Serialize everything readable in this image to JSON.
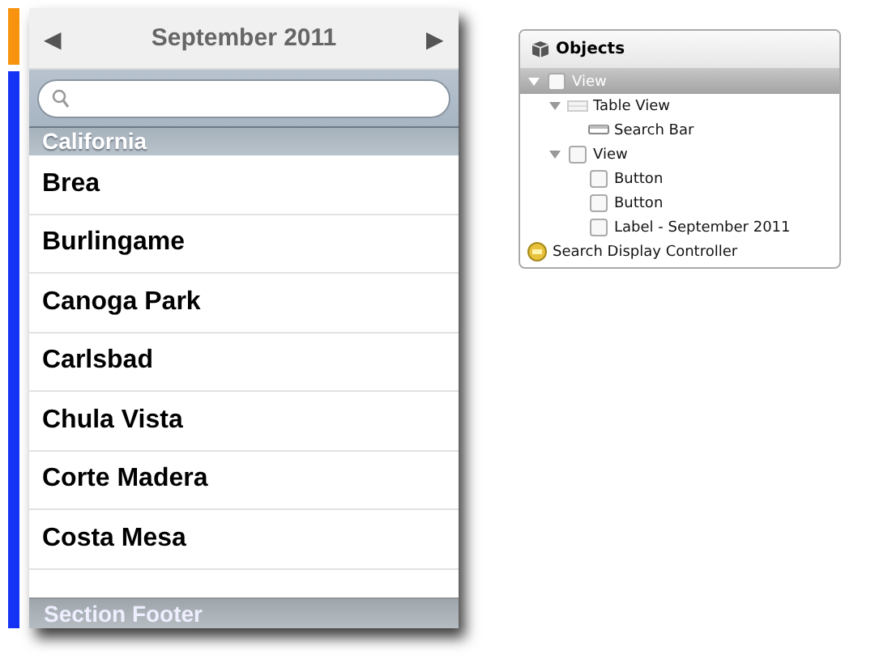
{
  "calendar_header": {
    "prev": "◀",
    "title": "September 2011",
    "next": "▶"
  },
  "table": {
    "section_header": "California",
    "rows": [
      "Brea",
      "Burlingame",
      "Canoga Park",
      "Carlsbad",
      "Chula Vista",
      "Corte Madera",
      "Costa Mesa"
    ],
    "section_footer": "Section Footer"
  },
  "objects_panel": {
    "title": "Objects",
    "tree": [
      {
        "label": "View",
        "kind": "view",
        "selected": true,
        "expanded": true,
        "children": [
          {
            "label": "Table View",
            "kind": "table",
            "selected": false,
            "expanded": true,
            "children": [
              {
                "label": "Search Bar",
                "kind": "searchbar",
                "selected": false
              }
            ]
          },
          {
            "label": "View",
            "kind": "view",
            "selected": false,
            "expanded": true,
            "children": [
              {
                "label": "Button",
                "kind": "button",
                "selected": false
              },
              {
                "label": "Button",
                "kind": "button",
                "selected": false
              },
              {
                "label": "Label - September 2011",
                "kind": "label",
                "selected": false
              }
            ]
          }
        ]
      },
      {
        "label": "Search Display Controller",
        "kind": "controller",
        "selected": false
      }
    ]
  }
}
